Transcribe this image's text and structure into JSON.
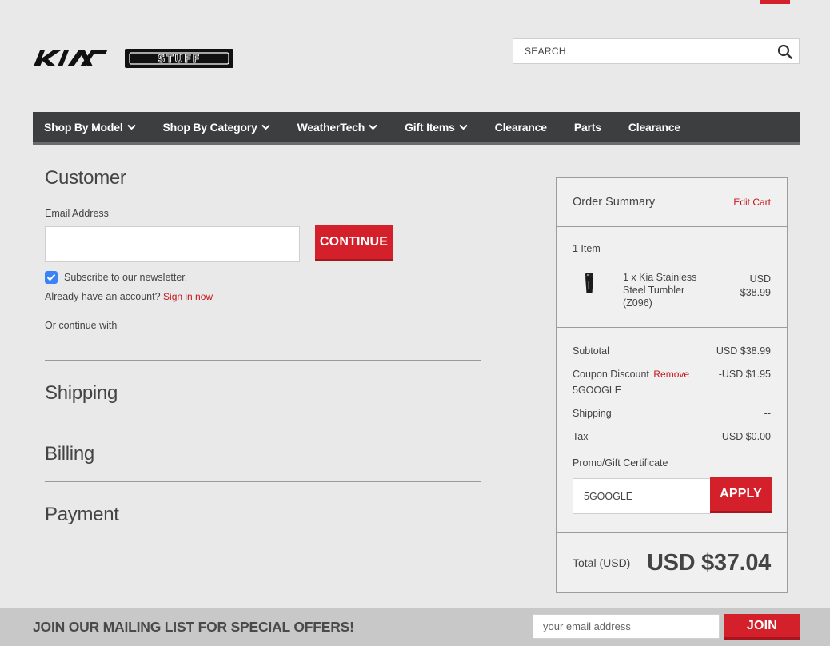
{
  "brand": {
    "logo_text": "KIA",
    "sublogo_text": "STUFF"
  },
  "search": {
    "placeholder": "SEARCH",
    "icon": "search-icon"
  },
  "nav": {
    "items": [
      {
        "label": "Shop By Model",
        "has_dropdown": true
      },
      {
        "label": "Shop By Category",
        "has_dropdown": true
      },
      {
        "label": "WeatherTech",
        "has_dropdown": true
      },
      {
        "label": "Gift Items",
        "has_dropdown": true
      },
      {
        "label": "Clearance",
        "has_dropdown": false
      },
      {
        "label": "Parts",
        "has_dropdown": false
      },
      {
        "label": "Clearance",
        "has_dropdown": false
      }
    ]
  },
  "customer": {
    "title": "Customer",
    "email_label": "Email Address",
    "email_value": "",
    "continue_label": "CONTINUE",
    "newsletter_label": "Subscribe to our newsletter.",
    "newsletter_checked": true,
    "account_prompt": "Already have an account?",
    "sign_in_label": "Sign in now",
    "continue_with": "Or continue with"
  },
  "steps": {
    "shipping": "Shipping",
    "billing": "Billing",
    "payment": "Payment"
  },
  "summary": {
    "title": "Order Summary",
    "edit_cart": "Edit Cart",
    "item_count": "1 Item",
    "item": {
      "name": "1 x Kia Stainless Steel Tumbler (Z096)",
      "currency": "USD",
      "price": "$38.99"
    },
    "subtotal_label": "Subtotal",
    "subtotal_value": "USD $38.99",
    "coupon_label": "Coupon Discount",
    "coupon_remove": "Remove",
    "coupon_code": "5GOOGLE",
    "coupon_value": "-USD $1.95",
    "shipping_label": "Shipping",
    "shipping_value": "--",
    "tax_label": "Tax",
    "tax_value": "USD $0.00",
    "promo_label": "Promo/Gift Certificate",
    "promo_value": "5GOOGLE",
    "apply_label": "APPLY",
    "total_label": "Total (USD)",
    "total_value": "USD $37.04"
  },
  "footer": {
    "mailing_text": "JOIN OUR MAILING LIST FOR SPECIAL OFFERS!",
    "email_placeholder": "your email address",
    "join_label": "JOIN"
  },
  "colors": {
    "accent": "#d4202a",
    "nav_bg": "#3d3e3f",
    "page_bg": "#e9e9ea",
    "checkbox": "#3b82f6"
  }
}
